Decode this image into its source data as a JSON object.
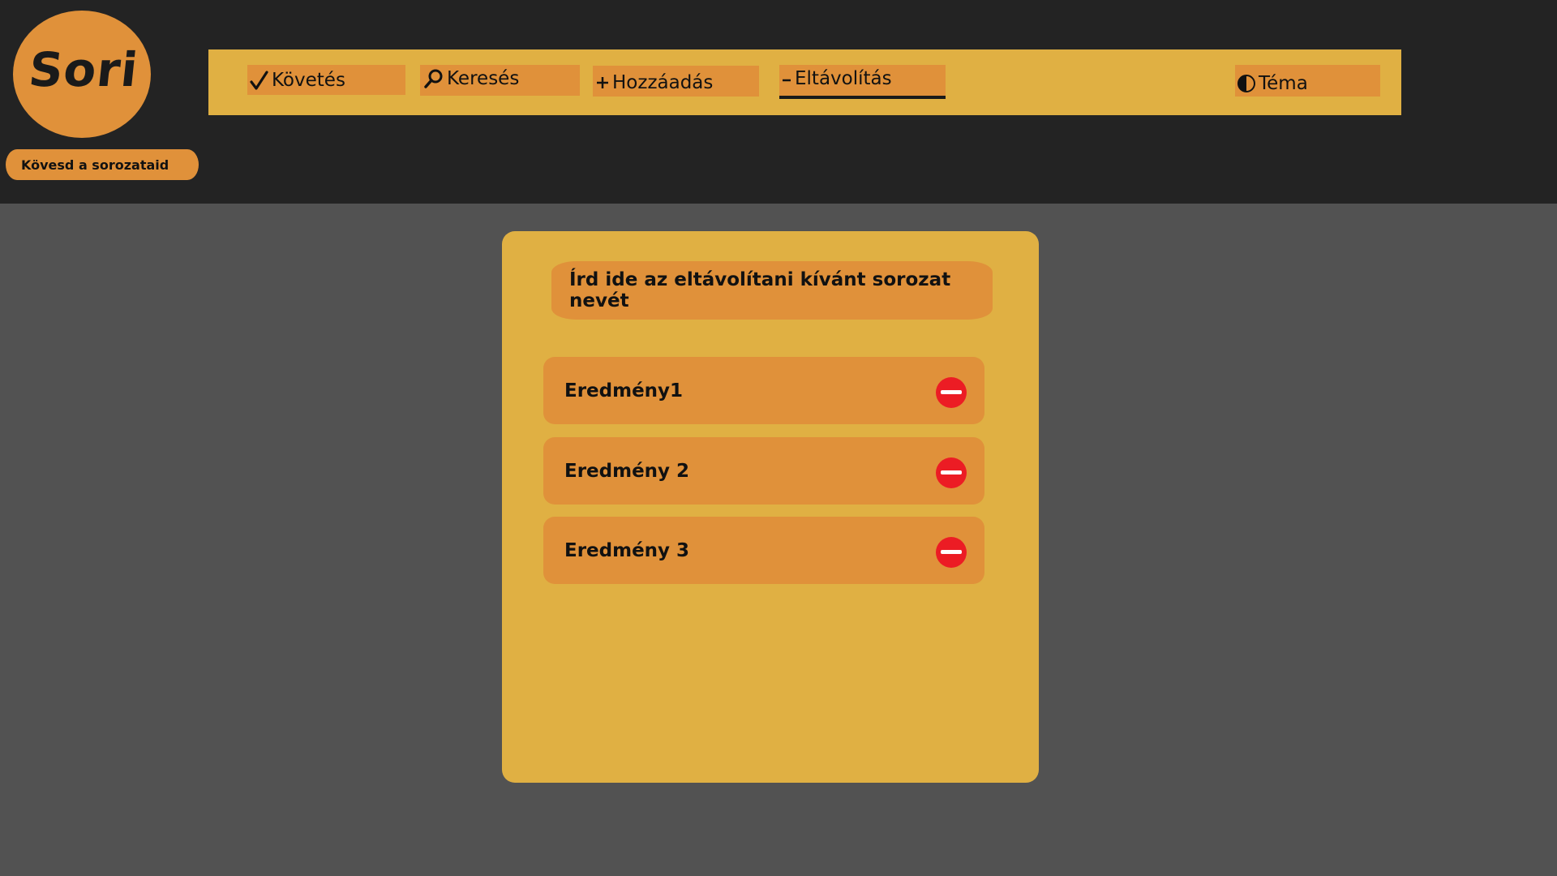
{
  "app": {
    "logo_text": "Sori",
    "tagline": "Kövesd a sorozataid"
  },
  "nav": {
    "items": [
      {
        "label": "Követés",
        "icon": "check-icon"
      },
      {
        "label": "Keresés",
        "icon": "search-icon"
      },
      {
        "label": "Hozzáadás",
        "icon": "plus-icon"
      },
      {
        "label": "Eltávolítás",
        "icon": "minus-icon",
        "active": true
      },
      {
        "label": "Téma",
        "icon": "half-circle-icon"
      }
    ]
  },
  "remove_panel": {
    "search_placeholder": "Írd ide az eltávolítani kívánt sorozat nevét",
    "results": [
      {
        "label": "Eredmény1",
        "action_icon": "remove-icon"
      },
      {
        "label": "Eredmény 2",
        "action_icon": "remove-icon"
      },
      {
        "label": "Eredmény 3",
        "action_icon": "remove-icon"
      }
    ]
  },
  "colors": {
    "header_bg": "#232323",
    "page_bg": "#525252",
    "accent_yellow": "#e0b043",
    "accent_orange": "#e0913a",
    "remove_red": "#ec1c24"
  }
}
